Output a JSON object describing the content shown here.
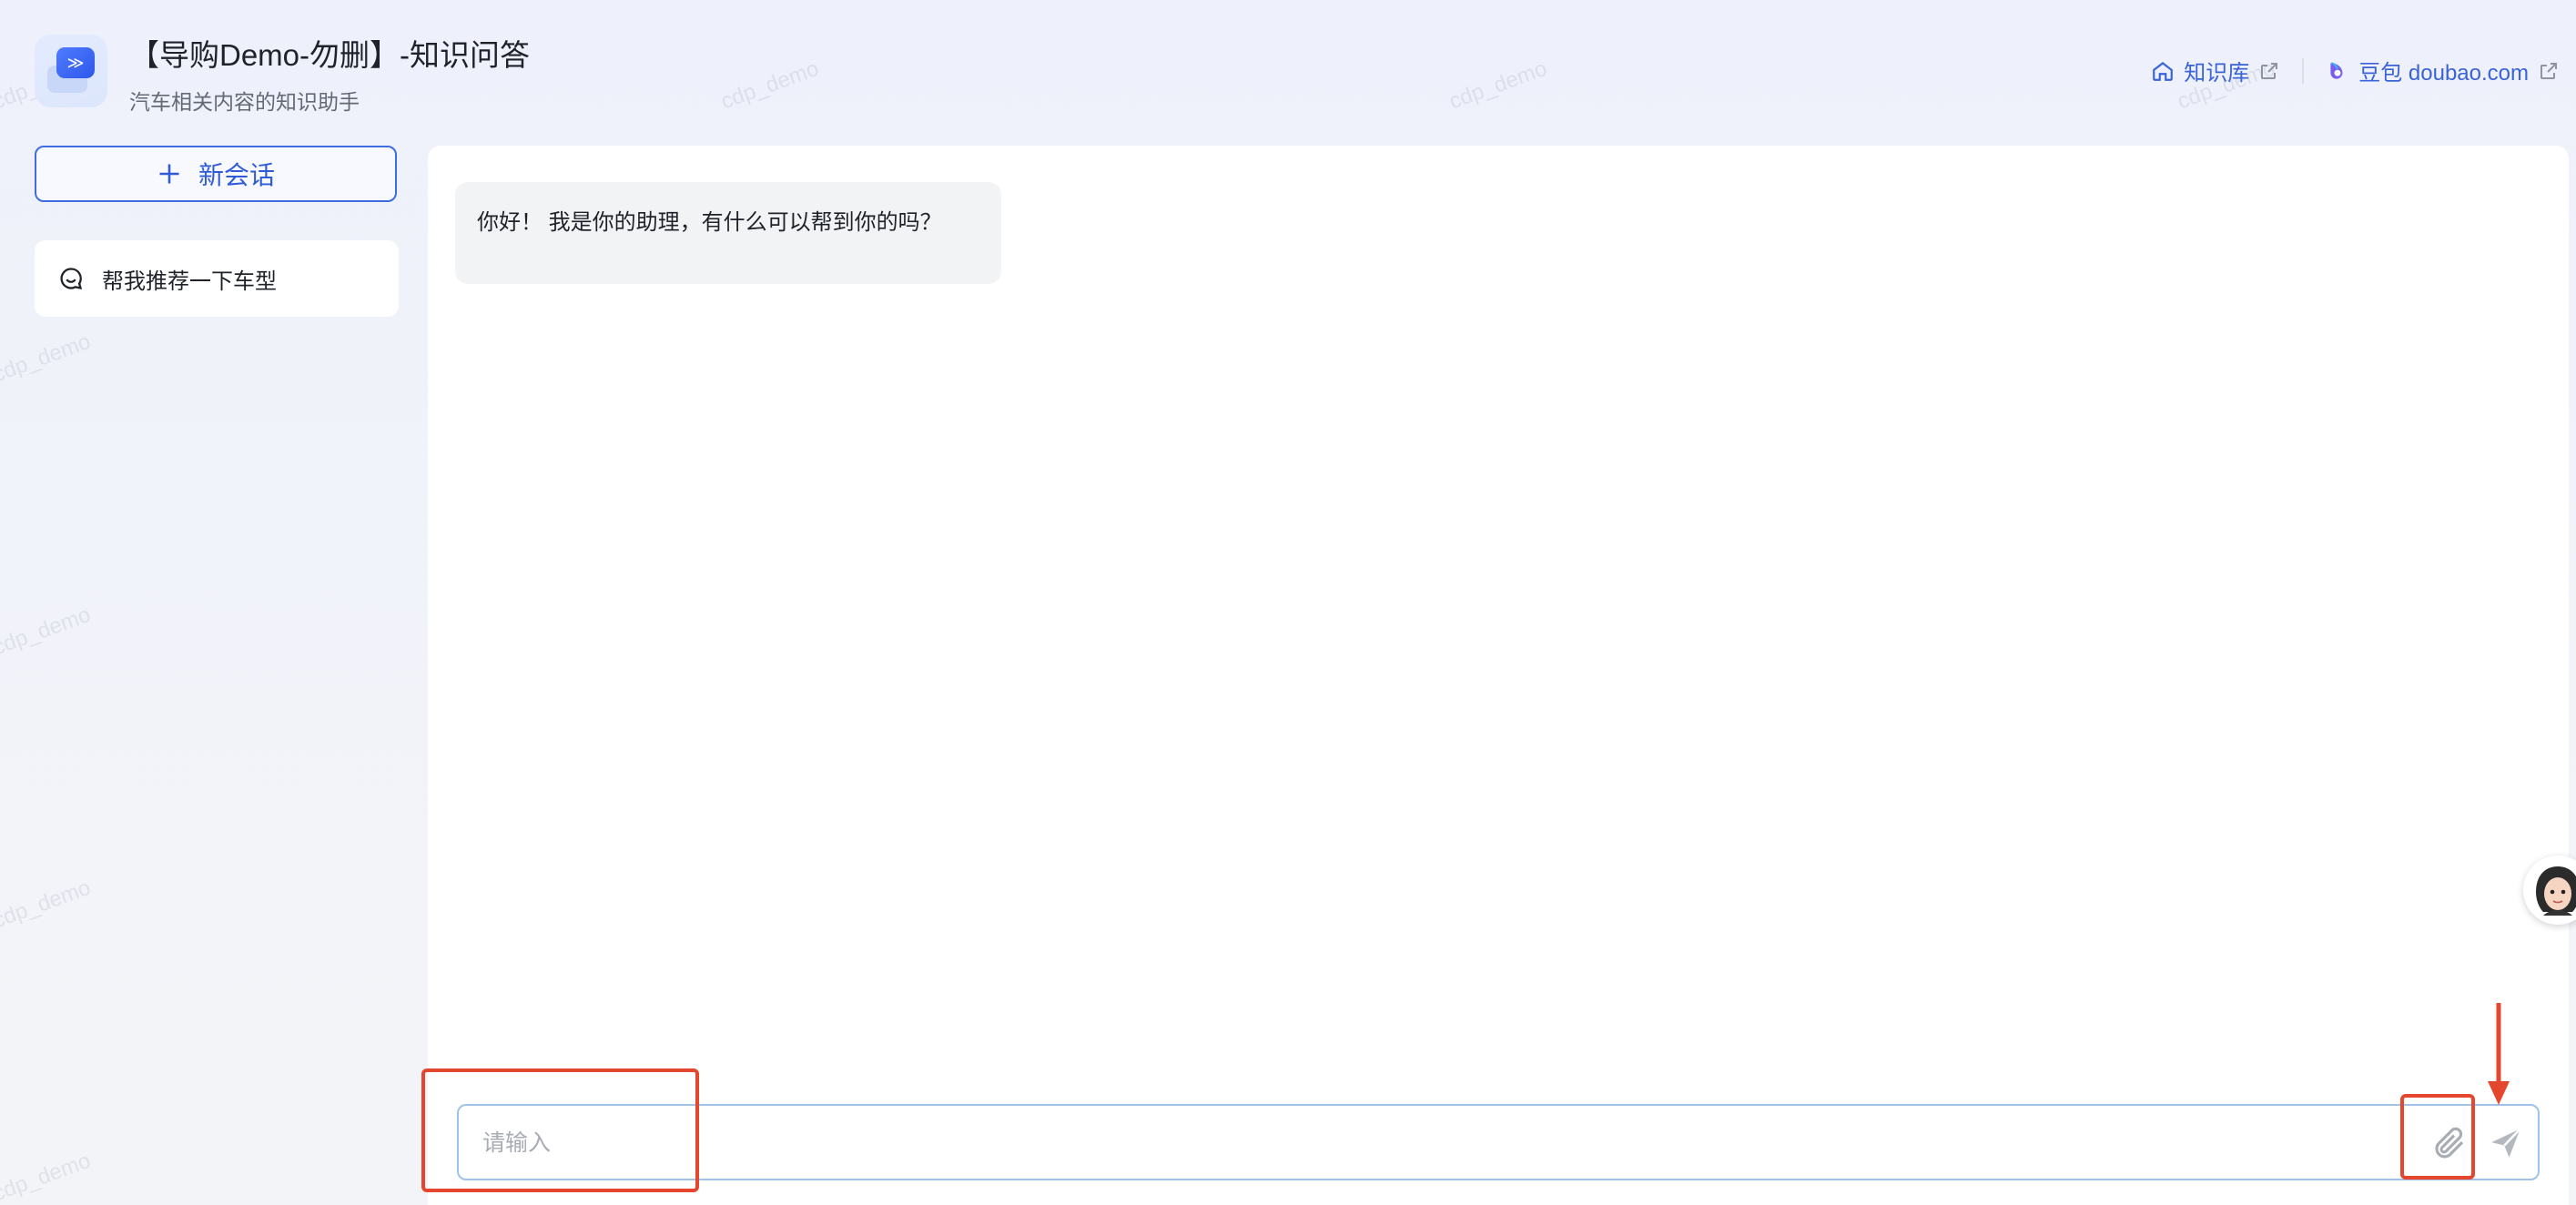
{
  "header": {
    "title": "【导购Demo-勿删】-知识问答",
    "subtitle": "汽车相关内容的知识助手",
    "links": [
      {
        "label": "知识库",
        "icon": "home-icon"
      },
      {
        "label": "豆包 doubao.com",
        "icon": "doubao-logo-icon"
      }
    ]
  },
  "watermark": "cdp_demo",
  "sidebar": {
    "new_chat_label": "新会话",
    "conversations": [
      {
        "label": "帮我推荐一下车型",
        "icon": "chat-bubble-icon"
      }
    ]
  },
  "chat": {
    "messages": [
      {
        "role": "assistant",
        "text": "你好！ 我是你的助理，有什么可以帮到你的吗？"
      }
    ]
  },
  "composer": {
    "placeholder": "请输入",
    "value": ""
  },
  "colors": {
    "accent": "#3e6de0",
    "annotation": "#e5472e",
    "input_border": "#9fc3e8"
  }
}
